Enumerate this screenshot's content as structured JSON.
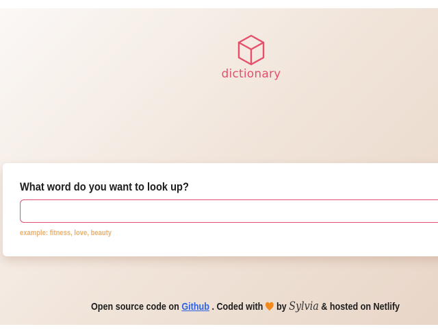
{
  "header": {
    "logo_text": "dictionary",
    "logo_icon": "cube-icon",
    "brand_color": "#e4506b"
  },
  "search": {
    "question": "What word do you want to look up?",
    "value": "",
    "placeholder": "",
    "hint": "example: fitness, love, beauty",
    "hint_color": "#e8b070"
  },
  "footer": {
    "text_before_link": "Open source code on",
    "link_label": "Github",
    "text_after_link": ". Coded with",
    "heart_icon": "orange-heart-icon",
    "by_label": "by",
    "author_signature": "Sylvia",
    "hosted_text": "& hosted on Netlify",
    "link_color": "#2d63e0"
  }
}
